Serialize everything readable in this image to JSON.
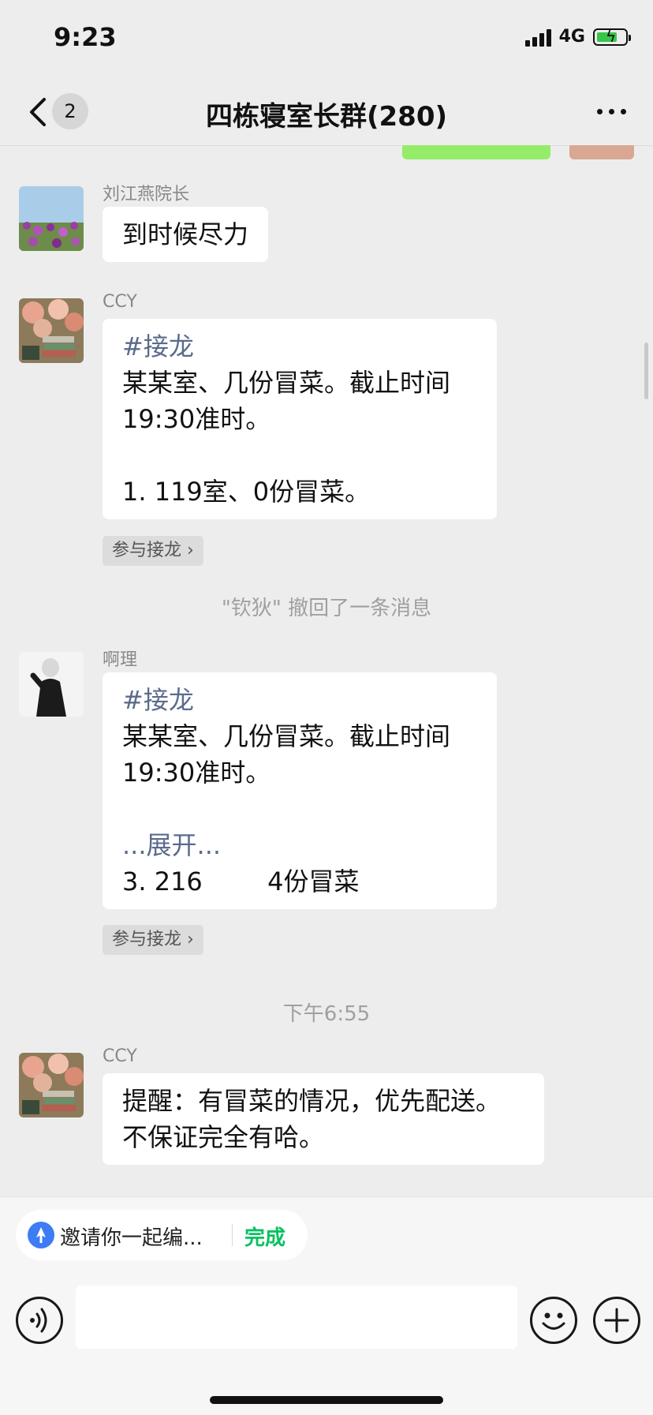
{
  "status_bar": {
    "time": "9:23",
    "network": "4G"
  },
  "nav": {
    "back_badge": "2",
    "title": "四栋寝室长群(280)"
  },
  "messages": [
    {
      "sender": "刘江燕院长",
      "text": "到时候尽力"
    },
    {
      "sender": "CCY",
      "tag": "#接龙",
      "line1": "某某室、几份冒菜。截止时间",
      "line2": "19:30准时。",
      "line3": "1. 119室、0份冒菜。",
      "join_label": "参与接龙"
    },
    {
      "sender": "啊理",
      "tag": "#接龙",
      "line1": "某某室、几份冒菜。截止时间",
      "line2": "19:30准时。",
      "expand": "...展开...",
      "line3": "3. 216",
      "line3b": "4份冒菜",
      "join_label": "参与接龙"
    },
    {
      "sender": "CCY",
      "line1": "提醒：有冒菜的情况，优先配送。",
      "line2": "不保证完全有哈。"
    }
  ],
  "system": {
    "recall": "\"钦狄\" 撤回了一条消息",
    "time": "下午6:55"
  },
  "invite": {
    "text": "邀请你一起编...",
    "done": "完成"
  },
  "colors": {
    "tag": "#5b6b8c",
    "done": "#07c160",
    "background": "#ededed"
  }
}
